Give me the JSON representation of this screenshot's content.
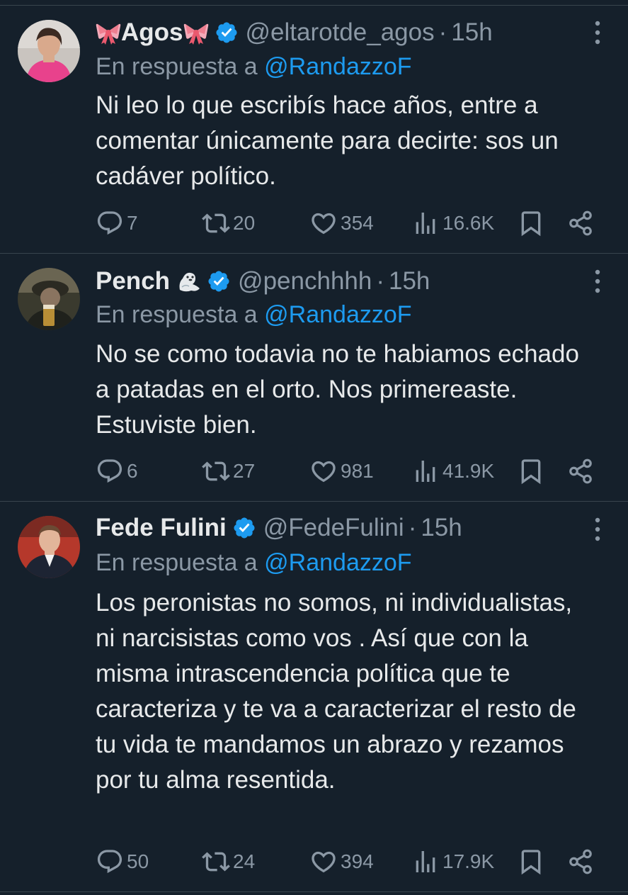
{
  "tweets": [
    {
      "display_name": "Agos",
      "name_emoji": "ribbon-icon",
      "handle": "@eltarotde_agos",
      "separator": "·",
      "time": "15h",
      "reply_prefix": "En respuesta a",
      "reply_to": "@RandazzoF",
      "text": "Ni leo lo que escribís hace años, entre a comentar únicamente para decirte: sos un cadáver político.",
      "replies": "7",
      "retweets": "20",
      "likes": "354",
      "views": "16.6K"
    },
    {
      "display_name": "Pench",
      "name_emoji": "seal-icon",
      "handle": "@penchhhh",
      "separator": "·",
      "time": "15h",
      "reply_prefix": "En respuesta a",
      "reply_to": "@RandazzoF",
      "text": "No se como todavia no te habiamos echado a patadas en el orto. Nos primereaste. Estuviste bien.",
      "replies": "6",
      "retweets": "27",
      "likes": "981",
      "views": "41.9K"
    },
    {
      "display_name": "Fede Fulini",
      "handle": "@FedeFulini",
      "separator": "·",
      "time": "15h",
      "reply_prefix": "En respuesta a",
      "reply_to": "@RandazzoF",
      "text": "Los peronistas no somos, ni individualistas, ni narcisistas como vos . Así que con la misma intrascendencia política que te caracteriza y te va a caracterizar el resto de tu vida te mandamos un abrazo y rezamos por tu alma resentida.",
      "replies": "50",
      "retweets": "24",
      "likes": "394",
      "views": "17.9K"
    }
  ],
  "colors": {
    "background": "#15202b",
    "text": "#e7e9ea",
    "secondary": "#8b98a5",
    "accent": "#1d9bf0",
    "divider": "#38444d"
  }
}
